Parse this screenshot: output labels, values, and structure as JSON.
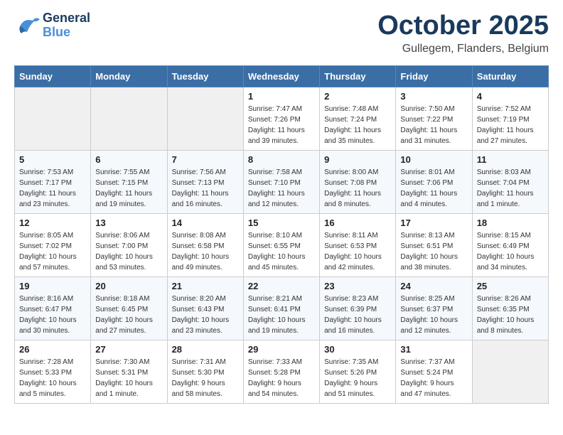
{
  "header": {
    "logo_general": "General",
    "logo_blue": "Blue",
    "month": "October 2025",
    "location": "Gullegem, Flanders, Belgium"
  },
  "days_of_week": [
    "Sunday",
    "Monday",
    "Tuesday",
    "Wednesday",
    "Thursday",
    "Friday",
    "Saturday"
  ],
  "weeks": [
    [
      {
        "day": "",
        "info": ""
      },
      {
        "day": "",
        "info": ""
      },
      {
        "day": "",
        "info": ""
      },
      {
        "day": "1",
        "info": "Sunrise: 7:47 AM\nSunset: 7:26 PM\nDaylight: 11 hours\nand 39 minutes."
      },
      {
        "day": "2",
        "info": "Sunrise: 7:48 AM\nSunset: 7:24 PM\nDaylight: 11 hours\nand 35 minutes."
      },
      {
        "day": "3",
        "info": "Sunrise: 7:50 AM\nSunset: 7:22 PM\nDaylight: 11 hours\nand 31 minutes."
      },
      {
        "day": "4",
        "info": "Sunrise: 7:52 AM\nSunset: 7:19 PM\nDaylight: 11 hours\nand 27 minutes."
      }
    ],
    [
      {
        "day": "5",
        "info": "Sunrise: 7:53 AM\nSunset: 7:17 PM\nDaylight: 11 hours\nand 23 minutes."
      },
      {
        "day": "6",
        "info": "Sunrise: 7:55 AM\nSunset: 7:15 PM\nDaylight: 11 hours\nand 19 minutes."
      },
      {
        "day": "7",
        "info": "Sunrise: 7:56 AM\nSunset: 7:13 PM\nDaylight: 11 hours\nand 16 minutes."
      },
      {
        "day": "8",
        "info": "Sunrise: 7:58 AM\nSunset: 7:10 PM\nDaylight: 11 hours\nand 12 minutes."
      },
      {
        "day": "9",
        "info": "Sunrise: 8:00 AM\nSunset: 7:08 PM\nDaylight: 11 hours\nand 8 minutes."
      },
      {
        "day": "10",
        "info": "Sunrise: 8:01 AM\nSunset: 7:06 PM\nDaylight: 11 hours\nand 4 minutes."
      },
      {
        "day": "11",
        "info": "Sunrise: 8:03 AM\nSunset: 7:04 PM\nDaylight: 11 hours\nand 1 minute."
      }
    ],
    [
      {
        "day": "12",
        "info": "Sunrise: 8:05 AM\nSunset: 7:02 PM\nDaylight: 10 hours\nand 57 minutes."
      },
      {
        "day": "13",
        "info": "Sunrise: 8:06 AM\nSunset: 7:00 PM\nDaylight: 10 hours\nand 53 minutes."
      },
      {
        "day": "14",
        "info": "Sunrise: 8:08 AM\nSunset: 6:58 PM\nDaylight: 10 hours\nand 49 minutes."
      },
      {
        "day": "15",
        "info": "Sunrise: 8:10 AM\nSunset: 6:55 PM\nDaylight: 10 hours\nand 45 minutes."
      },
      {
        "day": "16",
        "info": "Sunrise: 8:11 AM\nSunset: 6:53 PM\nDaylight: 10 hours\nand 42 minutes."
      },
      {
        "day": "17",
        "info": "Sunrise: 8:13 AM\nSunset: 6:51 PM\nDaylight: 10 hours\nand 38 minutes."
      },
      {
        "day": "18",
        "info": "Sunrise: 8:15 AM\nSunset: 6:49 PM\nDaylight: 10 hours\nand 34 minutes."
      }
    ],
    [
      {
        "day": "19",
        "info": "Sunrise: 8:16 AM\nSunset: 6:47 PM\nDaylight: 10 hours\nand 30 minutes."
      },
      {
        "day": "20",
        "info": "Sunrise: 8:18 AM\nSunset: 6:45 PM\nDaylight: 10 hours\nand 27 minutes."
      },
      {
        "day": "21",
        "info": "Sunrise: 8:20 AM\nSunset: 6:43 PM\nDaylight: 10 hours\nand 23 minutes."
      },
      {
        "day": "22",
        "info": "Sunrise: 8:21 AM\nSunset: 6:41 PM\nDaylight: 10 hours\nand 19 minutes."
      },
      {
        "day": "23",
        "info": "Sunrise: 8:23 AM\nSunset: 6:39 PM\nDaylight: 10 hours\nand 16 minutes."
      },
      {
        "day": "24",
        "info": "Sunrise: 8:25 AM\nSunset: 6:37 PM\nDaylight: 10 hours\nand 12 minutes."
      },
      {
        "day": "25",
        "info": "Sunrise: 8:26 AM\nSunset: 6:35 PM\nDaylight: 10 hours\nand 8 minutes."
      }
    ],
    [
      {
        "day": "26",
        "info": "Sunrise: 7:28 AM\nSunset: 5:33 PM\nDaylight: 10 hours\nand 5 minutes."
      },
      {
        "day": "27",
        "info": "Sunrise: 7:30 AM\nSunset: 5:31 PM\nDaylight: 10 hours\nand 1 minute."
      },
      {
        "day": "28",
        "info": "Sunrise: 7:31 AM\nSunset: 5:30 PM\nDaylight: 9 hours\nand 58 minutes."
      },
      {
        "day": "29",
        "info": "Sunrise: 7:33 AM\nSunset: 5:28 PM\nDaylight: 9 hours\nand 54 minutes."
      },
      {
        "day": "30",
        "info": "Sunrise: 7:35 AM\nSunset: 5:26 PM\nDaylight: 9 hours\nand 51 minutes."
      },
      {
        "day": "31",
        "info": "Sunrise: 7:37 AM\nSunset: 5:24 PM\nDaylight: 9 hours\nand 47 minutes."
      },
      {
        "day": "",
        "info": ""
      }
    ]
  ]
}
